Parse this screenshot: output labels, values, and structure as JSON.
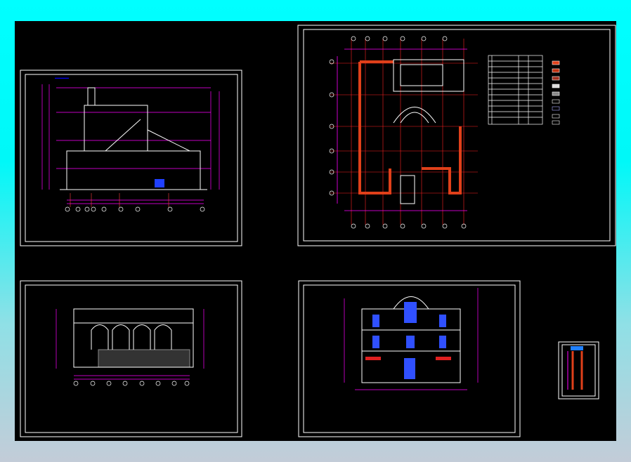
{
  "colors": {
    "canvas": "#000000",
    "frame": "#ffffff",
    "dimension": "#ff00ff",
    "wall": "#e0401a",
    "title": "#0000ff",
    "grid": "#ff2020",
    "line": "#ffffff"
  },
  "sheets": [
    {
      "id": "section",
      "kind": "building-section"
    },
    {
      "id": "floor-plan",
      "kind": "floor-plan-with-legend"
    },
    {
      "id": "section-2",
      "kind": "arcade-section"
    },
    {
      "id": "elevation",
      "kind": "front-elevation"
    },
    {
      "id": "detail",
      "kind": "wall-detail"
    }
  ]
}
